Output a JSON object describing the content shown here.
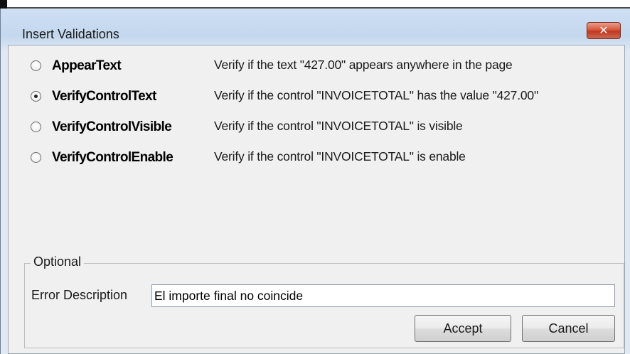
{
  "dialog": {
    "title": "Insert Validations",
    "close_glyph": "✕"
  },
  "options": [
    {
      "name": "AppearText",
      "description": "Verify if the text \"427.00\" appears anywhere in the page",
      "selected": false
    },
    {
      "name": "VerifyControlText",
      "description": "Verify if the control \"INVOICETOTAL\" has the value \"427.00\"",
      "selected": true
    },
    {
      "name": "VerifyControlVisible",
      "description": "Verify if the control \"INVOICETOTAL\" is visible",
      "selected": false
    },
    {
      "name": "VerifyControlEnable",
      "description": "Verify if the control \"INVOICETOTAL\" is enable",
      "selected": false
    }
  ],
  "optional": {
    "group_label": "Optional",
    "error_label": "Error Description",
    "error_value": "El importe final no coincide"
  },
  "buttons": {
    "accept": "Accept",
    "cancel": "Cancel"
  },
  "colors": {
    "close_button": "#c8412a",
    "frame": "#c3d7ee",
    "client": "#f0f0f0"
  }
}
